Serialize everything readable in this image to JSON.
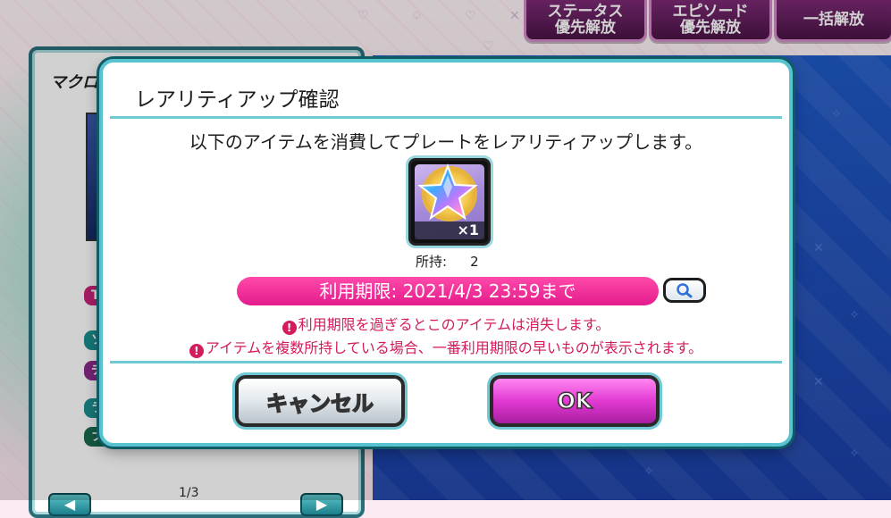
{
  "top_buttons": {
    "status_priority": [
      "ステータス",
      "優先解放"
    ],
    "episode_priority": [
      "エピソード",
      "優先解放"
    ],
    "bulk_release": "一括解放"
  },
  "left_panel": {
    "logo_text": "マクロス",
    "tag_total": "TOTAL",
    "tag_soul": "ソウル",
    "tag_charm": "チャーム",
    "tag_live": "ライブ",
    "tag_fold": "フォールド",
    "page_indicator": "1/3"
  },
  "dialog": {
    "title": "レアリティアップ確認",
    "message": "以下のアイテムを消費してプレートをレアリティアップします。",
    "item": {
      "icon": "rainbow-star-medal-icon",
      "quantity": "×1"
    },
    "owned_label": "所持:",
    "owned_value": "2",
    "expiry": "利用期限: 2021/4/3 23:59まで",
    "warnings": [
      "利用期限を過ぎるとこのアイテムは消失します。",
      "アイテムを複数所持している場合、一番利用期限の早いものが表示されます。"
    ],
    "cancel_label": "キャンセル",
    "ok_label": "OK"
  },
  "colors": {
    "accent_pink": "#e41b8c",
    "ok_magenta": "#e23ad3",
    "frame_teal": "#58c3cf",
    "warning_red": "#d31b5e"
  }
}
